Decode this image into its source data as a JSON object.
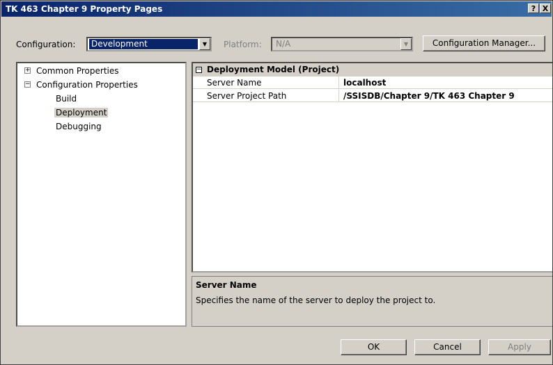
{
  "window": {
    "title": "TK 463 Chapter 9 Property Pages",
    "help_btn": "?",
    "close_btn": "X"
  },
  "toolbar": {
    "configuration_label": "Configuration:",
    "configuration_value": "Development",
    "platform_label": "Platform:",
    "platform_value": "N/A",
    "config_manager_label": "Configuration Manager..."
  },
  "tree": {
    "items": [
      {
        "label": "Common Properties",
        "expander": "+"
      },
      {
        "label": "Configuration Properties",
        "expander": "−"
      },
      {
        "label": "Build"
      },
      {
        "label": "Deployment",
        "selected": true
      },
      {
        "label": "Debugging"
      }
    ]
  },
  "grid": {
    "category": "Deployment Model (Project)",
    "category_expander": "−",
    "rows": [
      {
        "name": "Server Name",
        "value": "localhost"
      },
      {
        "name": "Server Project Path",
        "value": "/SSISDB/Chapter 9/TK 463 Chapter 9"
      }
    ]
  },
  "description": {
    "title": "Server Name",
    "text": "Specifies the name of the server to deploy the project to."
  },
  "buttons": {
    "ok": "OK",
    "cancel": "Cancel",
    "apply": "Apply"
  },
  "colors": {
    "title_start": "#0a246a",
    "title_end": "#3a6ea5",
    "selection": "#0a246a",
    "face": "#d4d0c8"
  }
}
